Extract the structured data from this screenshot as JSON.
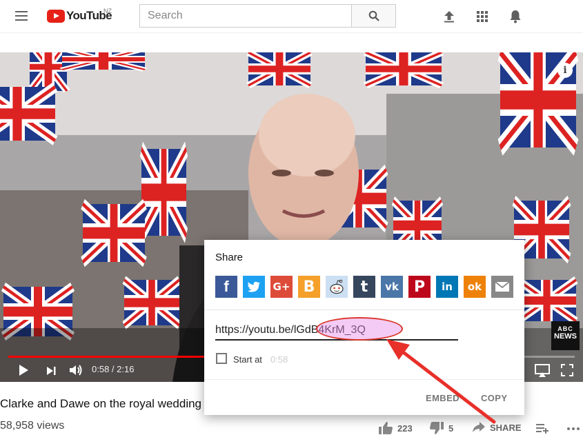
{
  "header": {
    "logo_text": "YouTube",
    "region": "NZ",
    "search_placeholder": "Search"
  },
  "player": {
    "time_display": "0:58 / 2:16",
    "progress": 0.43,
    "info_label": "i",
    "news_badge": {
      "brand": "ABC",
      "label": "NEWS"
    }
  },
  "video": {
    "title": "Clarke and Dawe on the royal wedding",
    "views": "58,958 views",
    "likes": "223",
    "dislikes": "5",
    "share_label": "SHARE"
  },
  "share_dialog": {
    "title": "Share",
    "services": [
      {
        "name": "facebook",
        "glyph": "f",
        "color": "#3b5998"
      },
      {
        "name": "twitter",
        "glyph": "",
        "color": "#1da1f2"
      },
      {
        "name": "google-plus",
        "glyph": "G+",
        "color": "#dd4b39"
      },
      {
        "name": "blogger",
        "glyph": "B",
        "color": "#f4a02a"
      },
      {
        "name": "reddit",
        "glyph": "",
        "color": "#ccdff3"
      },
      {
        "name": "tumblr",
        "glyph": "t",
        "color": "#36465d"
      },
      {
        "name": "vk",
        "glyph": "vk",
        "color": "#4a76a8"
      },
      {
        "name": "pinterest",
        "glyph": "P",
        "color": "#bd081c"
      },
      {
        "name": "linkedin",
        "glyph": "in",
        "color": "#0077b5"
      },
      {
        "name": "odnoklassniki",
        "glyph": "ok",
        "color": "#ee8208"
      },
      {
        "name": "email",
        "glyph": "",
        "color": "#888888"
      }
    ],
    "url": "https://youtu.be/lGdB4KrM_3Q",
    "start_at_label": "Start at",
    "start_at_time": "0:58",
    "embed_label": "EMBED",
    "copy_label": "COPY"
  },
  "annotation": {
    "highlight_color": "#d9372a"
  }
}
